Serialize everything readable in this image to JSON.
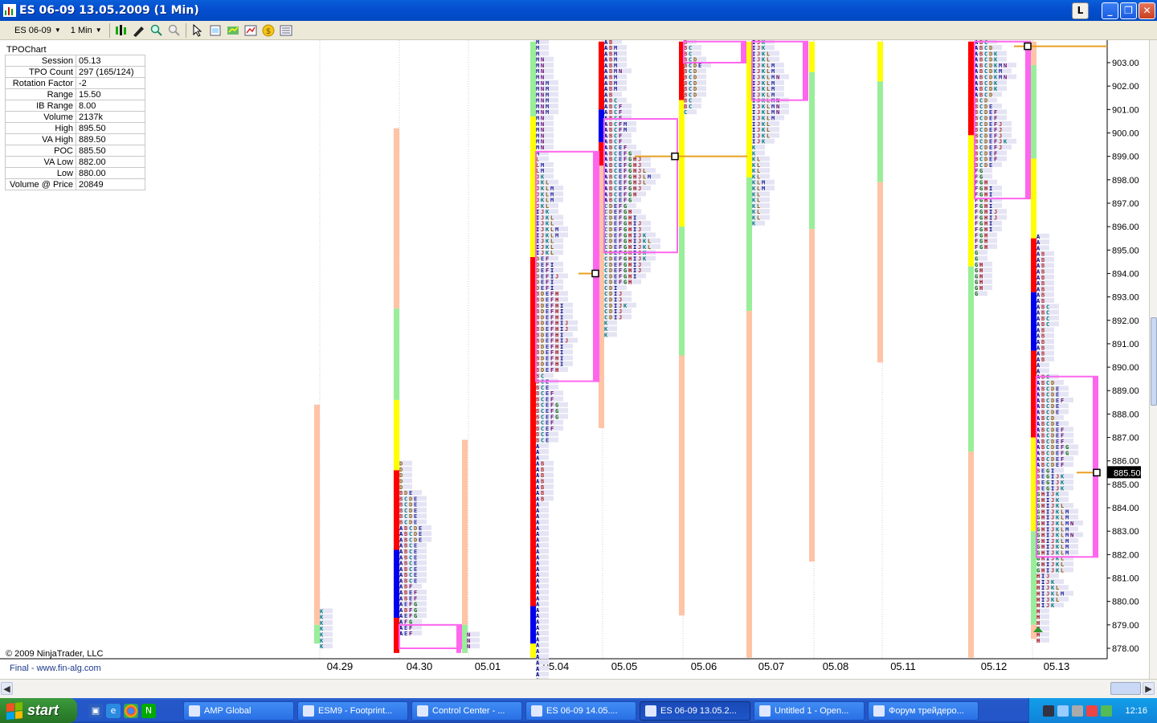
{
  "window": {
    "title": "ES 06-09  13.05.2009 (1 Min)",
    "btn_l": "L",
    "btn_min": "_",
    "btn_max": "❐",
    "btn_close": "✕"
  },
  "toolbar": {
    "instrument": "ES 06-09",
    "interval": "1 Min",
    "icons": [
      "bar-type-icon",
      "drawing-tools-icon",
      "zoom-in-icon",
      "zoom-out-icon",
      "cursor-icon",
      "properties-icon",
      "strategy-icon",
      "indicator-icon",
      "currency-icon",
      "data-box-icon"
    ]
  },
  "info_panel": {
    "title": "TPOChart",
    "rows": [
      {
        "key": "Session",
        "value": "05.13"
      },
      {
        "key": "TPO Count",
        "value": "297 (165/124)"
      },
      {
        "key": "Rotation Factor",
        "value": "-2"
      },
      {
        "key": "Range",
        "value": "15.50"
      },
      {
        "key": "IB Range",
        "value": "8.00"
      },
      {
        "key": "Volume",
        "value": "2137k"
      },
      {
        "key": "High",
        "value": "895.50"
      },
      {
        "key": "VA High",
        "value": "889.50"
      },
      {
        "key": "POC",
        "value": "885.50"
      },
      {
        "key": "VA Low",
        "value": "882.00"
      },
      {
        "key": "Low",
        "value": "880.00"
      },
      {
        "key": "Volume @ Price",
        "value": "20849"
      }
    ]
  },
  "footer": {
    "copyright": "© 2009 NinjaTrader, LLC",
    "final": "Final - www.fin-alg.com"
  },
  "chart_data": {
    "type": "tpo-profile",
    "y_axis_labels": [
      "903.00",
      "902.00",
      "901.00",
      "900.00",
      "899.00",
      "898.00",
      "897.00",
      "896.00",
      "895.00",
      "894.00",
      "893.00",
      "892.00",
      "891.00",
      "890.00",
      "889.00",
      "888.00",
      "887.00",
      "886.00",
      "885.00",
      "884.00",
      "883.00",
      "882.00",
      "881.00",
      "880.00",
      "879.00",
      "878.00"
    ],
    "ylim": [
      877.6,
      903.9
    ],
    "current_price": "885.50",
    "sessions": [
      "04.29",
      "04.30",
      "05.01",
      "05.04",
      "05.05",
      "05.06",
      "05.07",
      "05.08",
      "05.11",
      "05.12",
      "05.13"
    ],
    "colors": {
      "red": "#ff0000",
      "yellow": "#ffff00",
      "green": "#99ee99",
      "blue": "#0000ee",
      "salmon": "#ffc3a5",
      "pink": "#ff66ee",
      "orange": "#e8a020"
    }
  },
  "taskbar": {
    "start": "start",
    "tasks": [
      "AMP Global",
      "ESM9 - Footprint...",
      "Control Center - ...",
      "ES 06-09  14.05....",
      "ES 06-09  13.05.2...",
      "Untitled 1 - Open...",
      "Форум трейдеро..."
    ],
    "clock": "12:16"
  }
}
